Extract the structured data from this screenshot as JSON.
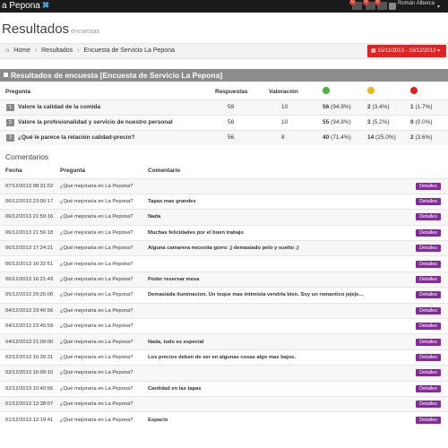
{
  "topbar": {
    "brand": "a Pepona",
    "brand_mark": "✖",
    "notif_badges": [
      "0",
      "0",
      "0"
    ],
    "user_name": "Román Alberca",
    "caret": "▾"
  },
  "page": {
    "title": "Resultados",
    "subtitle": "encuestas"
  },
  "breadcrumb": {
    "home": "Home",
    "sep": "›",
    "level1": "Resultados",
    "level2": "Encuesta de Servicio La Pepona"
  },
  "date_range": {
    "label": "15/11/2013 - 15/12/2013",
    "icon": "calendar-icon",
    "caret": "▾"
  },
  "results": {
    "title": "Resultados de encuesta [Encuesta de Servicio La Pepona]",
    "headers": {
      "pregunta": "Pregunta",
      "respuestas": "Respuestas",
      "valoracion": "Valoración"
    },
    "faces": {
      "good": "#4ab53b",
      "neutral": "#f0b51c",
      "bad": "#e02222"
    },
    "rows": [
      {
        "n": "1",
        "q": "Valore la calidad de la comida",
        "r": "59",
        "v": "10",
        "good_n": "56",
        "good_p": "(94.9%)",
        "neu_n": "2",
        "neu_p": "(3.4%)",
        "bad_n": "1",
        "bad_p": "(1.7%)"
      },
      {
        "n": "2",
        "q": "Valore la profesionalidad y servicio de nuestro personal",
        "r": "58",
        "v": "10",
        "good_n": "55",
        "good_p": "(94.8%)",
        "neu_n": "3",
        "neu_p": "(5.2%)",
        "bad_n": "0",
        "bad_p": "(0.0%)"
      },
      {
        "n": "3",
        "q": "¿Qué le parece la relación calidad-precio?",
        "r": "56",
        "v": "8",
        "good_n": "40",
        "good_p": "(71.4%)",
        "neu_n": "14",
        "neu_p": "(25.0%)",
        "bad_n": "2",
        "bad_p": "(3.6%)"
      }
    ]
  },
  "comments": {
    "title": "Comentarios",
    "headers": {
      "fecha": "Fecha",
      "pregunta": "Pregunta",
      "comentario": "Comentario"
    },
    "button_label": "Detalles",
    "rows": [
      {
        "fecha": "07/12/2013 08:31:02",
        "pregunta": "¿Qué mejoraría en La Pepona?",
        "comentario": ""
      },
      {
        "fecha": "06/12/2013 23:00:17",
        "pregunta": "¿Qué mejoraría en La Pepona?",
        "comentario": "Tapas mas grandes"
      },
      {
        "fecha": "06/12/2013 21:59:16",
        "pregunta": "¿Qué mejoraría en La Pepona?",
        "comentario": "Nada"
      },
      {
        "fecha": "06/12/2013 21:56:18",
        "pregunta": "¿Qué mejoraría en La Pepona?",
        "comentario": "Muchas felicidades por el buen trabajo"
      },
      {
        "fecha": "06/12/2013 17:24:21",
        "pregunta": "¿Qué mejoraría en La Pepona?",
        "comentario": "Alguna camarera necesita gorro ;) demasiado pelo y suelto ;)"
      },
      {
        "fecha": "06/12/2013 16:32:51",
        "pregunta": "¿Qué mejoraría en La Pepona?",
        "comentario": ""
      },
      {
        "fecha": "06/12/2013 16:21:43",
        "pregunta": "¿Qué mejoraría en La Pepona?",
        "comentario": "Poder reservar mesa"
      },
      {
        "fecha": "05/12/2013 20:26:00",
        "pregunta": "¿Qué mejoraría en La Pepona?",
        "comentario": "Demasiada iluminacion. Un toque mas intimista vendria bien. Soy un romantico jejeje..."
      },
      {
        "fecha": "04/12/2013 23:46:56",
        "pregunta": "¿Qué mejoraría en La Pepona?",
        "comentario": ""
      },
      {
        "fecha": "04/12/2013 23:45:59",
        "pregunta": "¿Qué mejoraría en La Pepona?",
        "comentario": ""
      },
      {
        "fecha": "04/12/2013 21:09:00",
        "pregunta": "¿Qué mejoraría en La Pepona?",
        "comentario": "Nada, todo es especial"
      },
      {
        "fecha": "02/12/2013 16:39:31",
        "pregunta": "¿Qué mejoraría en La Pepona?",
        "comentario": "Los precios deben de ser en algunas cosas algo mas bajos."
      },
      {
        "fecha": "02/12/2013 16:09:10",
        "pregunta": "¿Qué mejoraría en La Pepona?",
        "comentario": ""
      },
      {
        "fecha": "02/12/2013 10:40:56",
        "pregunta": "¿Qué mejoraría en La Pepona?",
        "comentario": "Cantidad en las tapas"
      },
      {
        "fecha": "01/12/2013 12:38:07",
        "pregunta": "¿Qué mejoraría en La Pepona?",
        "comentario": ""
      },
      {
        "fecha": "01/12/2013 12:19:41",
        "pregunta": "¿Qué mejoraría en La Pepona?",
        "comentario": "Espacio"
      }
    ]
  }
}
